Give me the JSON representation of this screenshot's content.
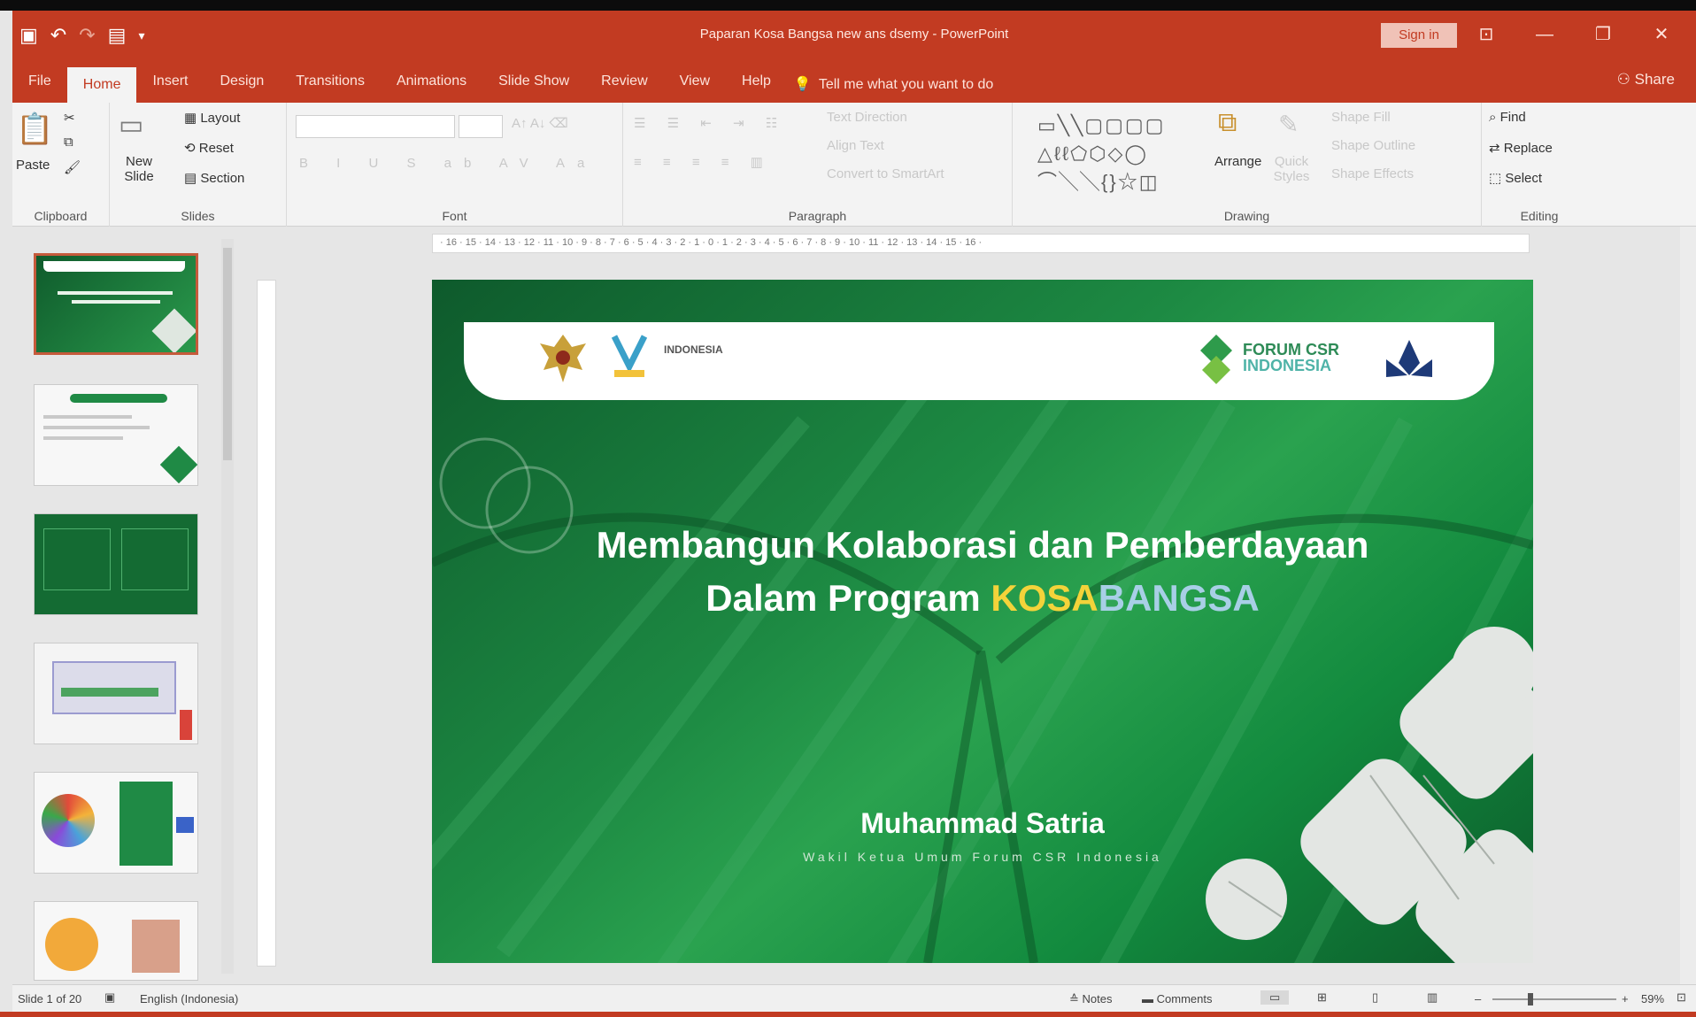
{
  "app": {
    "window_title": "Paparan Kosa Bangsa new ans dsemy - PowerPoint",
    "sign_in": "Sign in",
    "share": "Share",
    "window_buttons": [
      "⊡",
      "—",
      "❐",
      "✕"
    ],
    "qat_icons": [
      "save-icon",
      "undo-icon",
      "redo-icon",
      "start-from-beginning-icon",
      "customize-icon"
    ]
  },
  "tabs": [
    {
      "label": "File",
      "active": false
    },
    {
      "label": "Home",
      "active": true
    },
    {
      "label": "Insert",
      "active": false
    },
    {
      "label": "Design",
      "active": false
    },
    {
      "label": "Transitions",
      "active": false
    },
    {
      "label": "Animations",
      "active": false
    },
    {
      "label": "Slide Show",
      "active": false
    },
    {
      "label": "Review",
      "active": false
    },
    {
      "label": "View",
      "active": false
    },
    {
      "label": "Help",
      "active": false
    }
  ],
  "tell_me": "Tell me what you want to do",
  "ribbon": {
    "clipboard": {
      "label": "Clipboard",
      "paste": "Paste"
    },
    "slides": {
      "label": "Slides",
      "new_slide": "New Slide",
      "layout": "Layout",
      "reset": "Reset",
      "section": "Section"
    },
    "font": {
      "label": "Font"
    },
    "paragraph": {
      "label": "Paragraph",
      "text_direction": "Text Direction",
      "align_text": "Align Text",
      "convert_smartart": "Convert to SmartArt"
    },
    "drawing": {
      "label": "Drawing",
      "arrange": "Arrange",
      "quick_styles": "Quick Styles",
      "shape_fill": "Shape Fill",
      "shape_outline": "Shape Outline",
      "shape_effects": "Shape Effects"
    },
    "editing": {
      "label": "Editing",
      "find": "Find",
      "replace": "Replace",
      "select": "Select"
    }
  },
  "ruler_numbers": "· 16 · 15 · 14 · 13 · 12 · 11 · 10 · 9 · 8 · 7 · 6 · 5 · 4 · 3 · 2 · 1 · 0 · 1 · 2 · 3 · 4 · 5 · 6 · 7 · 8 · 9 · 10 · 11 · 12 · 13 · 14 · 15 · 16 ·",
  "slide": {
    "title_line1": "Membangun Kolaborasi dan Pemberdayaan",
    "title_line2_prefix": "Dalam Program ",
    "title_kosa": "KOSA",
    "title_bangsa": "BANGSA",
    "presenter": "Muhammad Satria",
    "role": "Wakil Ketua Umum Forum CSR Indonesia",
    "logo_right_text1": "FORUM CSR",
    "logo_right_text2": "INDONESIA",
    "logo_left_text": "INDONESIA"
  },
  "status": {
    "slide_info": "Slide 1 of 20",
    "language": "English (Indonesia)",
    "notes": "Notes",
    "comments": "Comments",
    "zoom": "59%"
  },
  "colors": {
    "accent": "#c23b22",
    "slide_green": "#1d8a43",
    "kosa_yellow": "#f3d33a",
    "bangsa_blue": "#a8cfe6"
  }
}
